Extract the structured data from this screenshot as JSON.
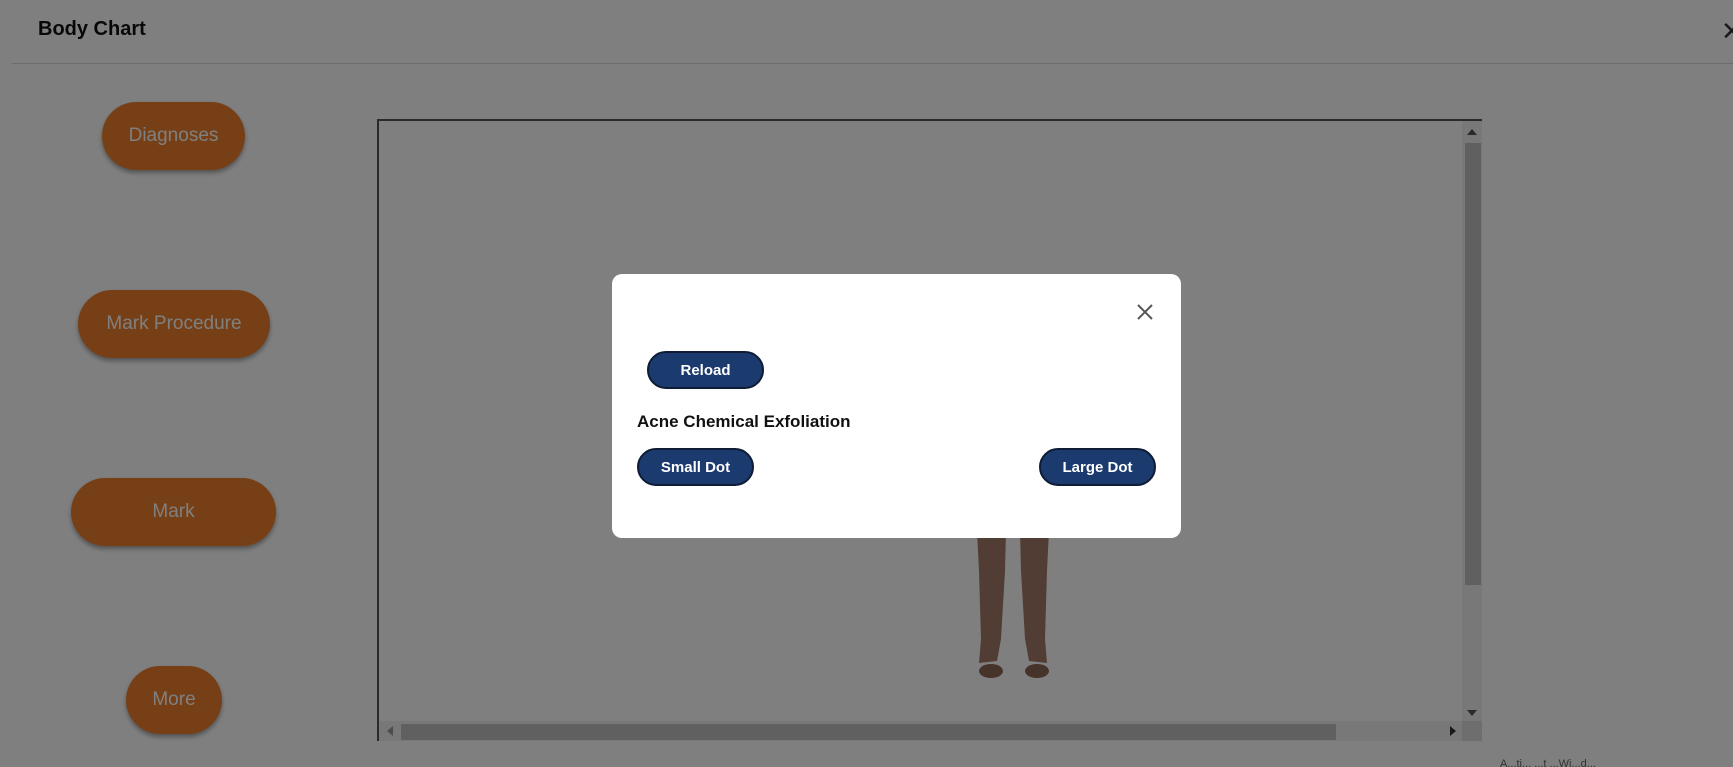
{
  "header": {
    "title": "Body Chart",
    "close_glyph": "✕"
  },
  "sidebar": {
    "buttons": [
      {
        "label": "Diagnoses"
      },
      {
        "label": "Mark Procedure"
      },
      {
        "label": "Mark"
      },
      {
        "label": "More"
      }
    ]
  },
  "modal": {
    "reload_label": "Reload",
    "procedure_name": "Acne Chemical Exfoliation",
    "small_dot_label": "Small Dot",
    "large_dot_label": "Large Dot"
  },
  "footer": {
    "text": "A...ti... ...t ...Wi...d..."
  },
  "colors": {
    "accent_orange": "#ee7f2c",
    "navy_button": "#1b3a6e",
    "overlay": "rgba(0,0,0,0.5)"
  },
  "icons": {
    "header_close": "close-icon",
    "modal_close": "close-icon"
  }
}
